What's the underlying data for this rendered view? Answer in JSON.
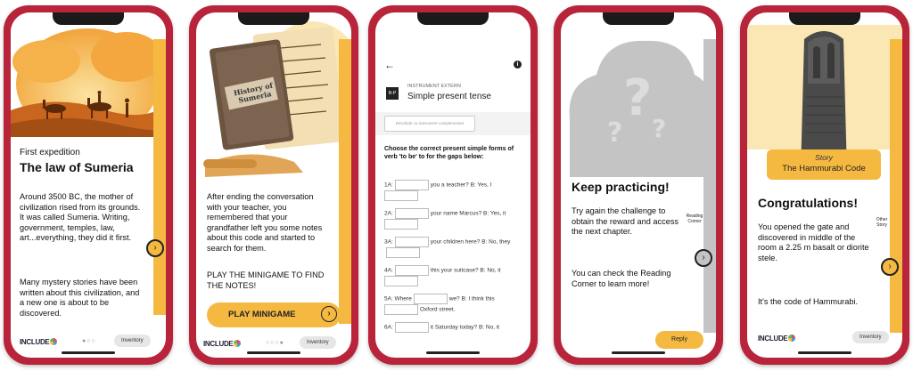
{
  "colors": {
    "frame": "#b8243a",
    "accent": "#f5b942",
    "dark": "#222222"
  },
  "phone1": {
    "subtitle": "First expedition",
    "title": "The law of Sumeria",
    "text1": "Around 3500 BC, the mother of civilization rised from its grounds. It was called Sumeria. Writing, government, temples, law, art...everything, they did it first.",
    "text2": "Many mystery stories have been written about this civilization, and a new one is about to be discovered.",
    "logo": "INCLUDE",
    "inventory": "Inventory",
    "next_icon": "chevron-right-icon"
  },
  "phone2": {
    "book_label": "History of Sumeria",
    "text": "After ending the conversation with your teacher, you remembered that your grandfather left you some notes about this code and started to search for them.",
    "cta": "PLAY THE MINIGAME TO FIND THE NOTES!",
    "button": "PLAY MINIGAME",
    "logo": "INCLUDE",
    "inventory": "Inventory"
  },
  "phone3": {
    "back_icon": "back-arrow-icon",
    "info_icon": "info-icon",
    "instrument_label": "INSTRUMENT EXTERN",
    "title": "Simple present tense",
    "button_placeholder": "Deschide cu instrument complementar",
    "question": "Choose the correct present simple forms of verb 'to be' to for the gaps below:",
    "items": [
      {
        "pre": "1A:",
        "post": "you a teacher? B: Yes, I"
      },
      {
        "pre": "2A:",
        "post": "your name Marcus? B: Yes, it"
      },
      {
        "pre": "3A:",
        "post": "your children here? B: No, they"
      },
      {
        "pre": "4A:",
        "post": "this your suitcase? B: No, it"
      },
      {
        "pre": "5A: Where",
        "post": "we? B: I think this",
        "tail": "Oxford street."
      },
      {
        "pre": "6A:",
        "post": "it Saturday today? B: No, it"
      }
    ]
  },
  "phone4": {
    "title": "Keep practicing!",
    "text1": "Try again the challenge to obtain the reward and access the next chapter.",
    "text2": "You can check the Reading Corner to learn more!",
    "side_label": "Reading Corner",
    "button": "Reply"
  },
  "phone5": {
    "story_label": "Story",
    "story_title": "The Hammurabi Code",
    "title": "Congratulations!",
    "text1": "You opened the gate and discovered in middle of the room a 2.25 m basalt or diorite stele.",
    "text2": "It's the code of Hammurabi.",
    "side_label": "Other Story",
    "logo": "INCLUDE",
    "inventory": "Inventory"
  }
}
